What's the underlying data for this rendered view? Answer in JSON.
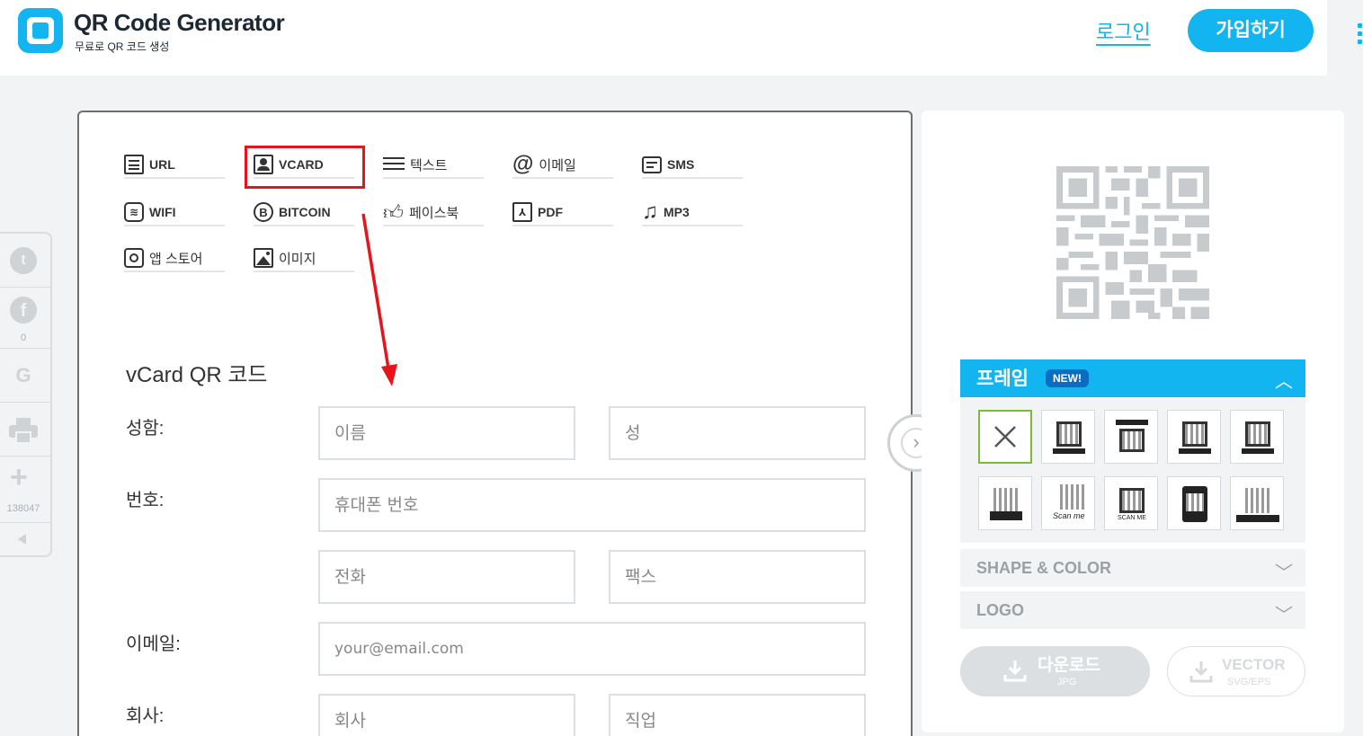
{
  "header": {
    "title": "QR Code Generator",
    "subtitle": "무료로 QR 코드 생성",
    "login": "로그인",
    "signup": "가입하기"
  },
  "social": {
    "facebook_count": "0",
    "share_count": "138047"
  },
  "types": {
    "url": "URL",
    "vcard": "VCARD",
    "text": "텍스트",
    "email": "이메일",
    "sms": "SMS",
    "wifi": "WIFI",
    "bitcoin": "BITCOIN",
    "facebook": "페이스북",
    "pdf": "PDF",
    "mp3": "MP3",
    "appstore": "앱 스토어",
    "image": "이미지"
  },
  "form": {
    "title": "vCard QR 코드",
    "name_label": "성함:",
    "first_name_ph": "이름",
    "last_name_ph": "성",
    "phone_label": "번호:",
    "mobile_ph": "휴대폰 번호",
    "tel_ph": "전화",
    "fax_ph": "팩스",
    "email_label": "이메일:",
    "email_ph": "your@email.com",
    "company_label": "회사:",
    "company_ph": "회사",
    "job_ph": "직업"
  },
  "panel": {
    "frame_title": "프레임",
    "new_badge": "NEW!",
    "shape_color": "SHAPE & COLOR",
    "logo": "LOGO",
    "download": "다운로드",
    "download_sub": "JPG",
    "vector": "VECTOR",
    "vector_sub": "SVG/EPS"
  },
  "colors": {
    "accent": "#12b5ef",
    "highlight": "#e8141c"
  }
}
